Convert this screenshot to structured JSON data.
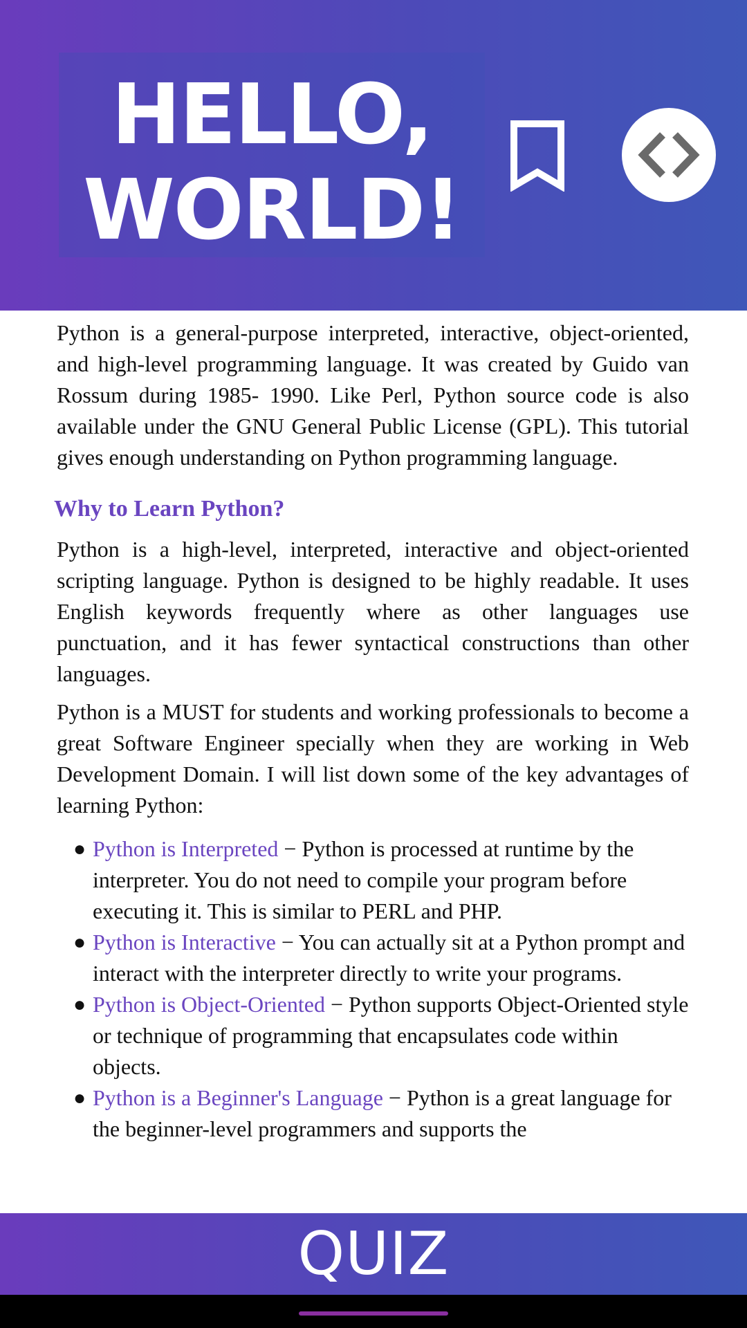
{
  "header": {
    "title_line1": "HELLO,",
    "title_line2": "WORLD!",
    "gradient_start": "#6a3cbc",
    "gradient_end": "#3f57b8",
    "bookmark_icon": "bookmark-outline-icon",
    "code_icon": "code-brackets-icon"
  },
  "content": {
    "intro": "Python is a general-purpose interpreted, interactive, object-oriented, and high-level programming language. It was created by Guido van Rossum during 1985- 1990. Like Perl, Python source code is also available under the GNU General Public License (GPL). This tutorial gives enough understanding on Python programming language.",
    "heading": "Why to Learn Python?",
    "para1": "Python is a high-level, interpreted, interactive and object-oriented scripting language. Python is designed to be highly readable. It uses English keywords frequently where as other languages use punctuation, and it has fewer syntactical constructions than other languages.",
    "para2": "Python is a MUST for students and working professionals to become a great Software Engineer specially when they are working in Web Development Domain. I will list down some of the key advantages of learning Python:",
    "bullets": [
      {
        "term": "Python is Interpreted",
        "text": " − Python is processed at runtime by the interpreter. You do not need to compile your program before executing it. This is similar to PERL and PHP."
      },
      {
        "term": "Python is Interactive",
        "text": " − You can actually sit at a Python prompt and interact with the interpreter directly to write your programs."
      },
      {
        "term": "Python is Object-Oriented",
        "text": " − Python supports Object-Oriented style or technique of programming that encapsulates code within objects."
      },
      {
        "term": "Python is a Beginner's Language",
        "text": " − Python is a great language for the beginner-level programmers and supports the"
      }
    ],
    "link_color": "#6a45c0"
  },
  "quiz": {
    "label": "QUIZ"
  }
}
